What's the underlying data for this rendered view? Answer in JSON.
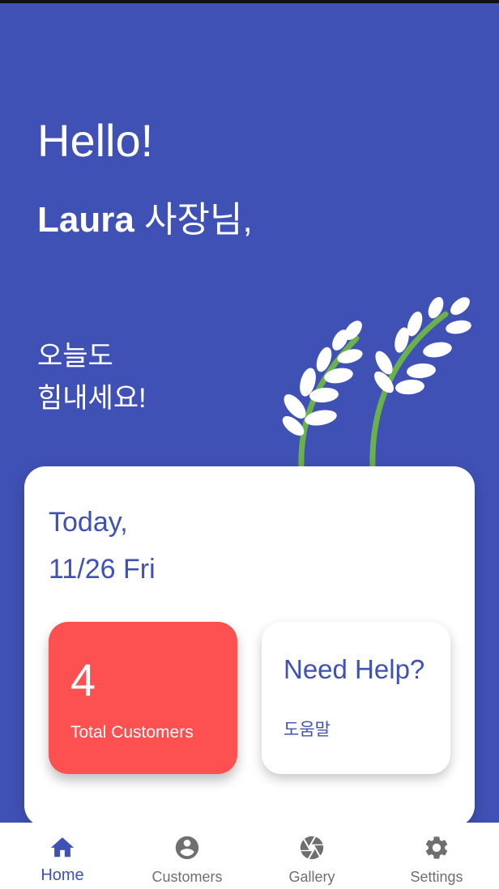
{
  "header": {
    "hello": "Hello!",
    "name": "Laura",
    "name_suffix": " 사장님,",
    "cheer_line1": "오늘도",
    "cheer_line2": "힘내세요!"
  },
  "card": {
    "today_label": "Today,",
    "date": "11/26 Fri",
    "customers": {
      "count": "4",
      "label": "Total Customers"
    },
    "help": {
      "title": "Need Help?",
      "subtitle": "도움말"
    }
  },
  "nav": {
    "items": [
      {
        "label": "Home",
        "icon": "home-icon",
        "active": true
      },
      {
        "label": "Customers",
        "icon": "account-circle-icon",
        "active": false
      },
      {
        "label": "Gallery",
        "icon": "camera-shutter-icon",
        "active": false
      },
      {
        "label": "Settings",
        "icon": "gear-icon",
        "active": false
      }
    ]
  },
  "colors": {
    "primary": "#3f51b5",
    "accent_red": "#fd5050",
    "leaf_stem": "#6ab04c",
    "nav_inactive": "#6f6f6f"
  }
}
